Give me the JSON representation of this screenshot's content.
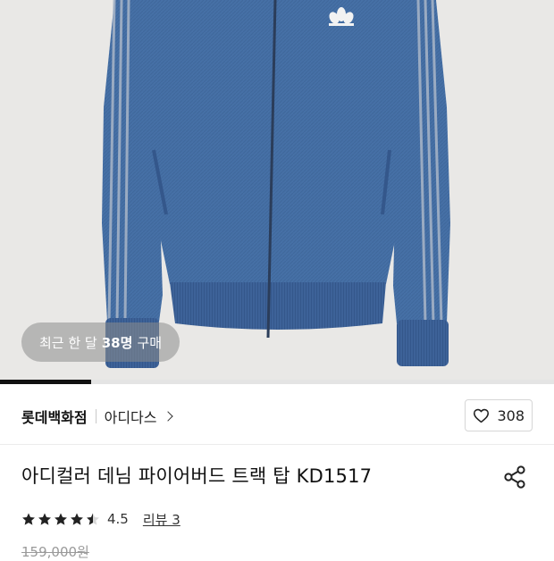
{
  "product_image": {
    "badge_prefix": "최근 한 달",
    "badge_count": "38명",
    "badge_suffix": "구매",
    "carousel_progress": 0.165
  },
  "store": {
    "store_name": "롯데백화점",
    "brand_name": "아디다스"
  },
  "wishlist": {
    "count": "308"
  },
  "product": {
    "title": "아디컬러 데님 파이어버드 트랙 탑 KD1517",
    "rating": 4.5,
    "rating_text": "4.5",
    "review_label": "리뷰 3",
    "original_price": "159,000원"
  },
  "icons": {
    "wishlist": "heart-icon",
    "share": "share-icon",
    "store_link": "chevron-right-icon",
    "rating": "star-icon"
  },
  "colors": {
    "denim": "#4670a6",
    "ribbing": "#3b5f95",
    "stripe": "#a9b6c8",
    "background": "#e9e8e6"
  }
}
